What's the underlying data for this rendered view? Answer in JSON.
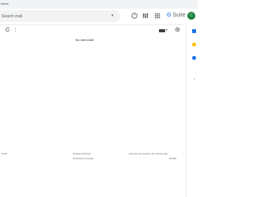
{
  "window": {
    "title": "Inbox"
  },
  "search": {
    "placeholder": "Search mail"
  },
  "header": {
    "brand_g": "G",
    "brand_text": " Suite",
    "avatar_letter": "C"
  },
  "main": {
    "empty_message": "No new mail!"
  },
  "footer": {
    "left": "0 GB",
    "policies": "Program Policies",
    "powered": "Powered by Google",
    "activity": "Last account activity: 45 minutes ago",
    "details": "Details"
  },
  "colors": {
    "accent_blue": "#1a73e8",
    "brand_blue": "#4285f4",
    "avatar_green": "#188038",
    "keep_yellow": "#fbbc04",
    "search_bg": "#f1f3f4"
  },
  "icons": {
    "support": "help-icon",
    "settings": "gear-icon",
    "filter": "filter-icon",
    "apps": "apps-grid-icon",
    "refresh": "refresh-icon",
    "more": "more-vert-icon",
    "keyboard": "keyboard-icon",
    "calendar": "calendar-icon",
    "keep": "keep-icon",
    "tasks": "tasks-icon",
    "expand": "chevron-right-icon"
  }
}
